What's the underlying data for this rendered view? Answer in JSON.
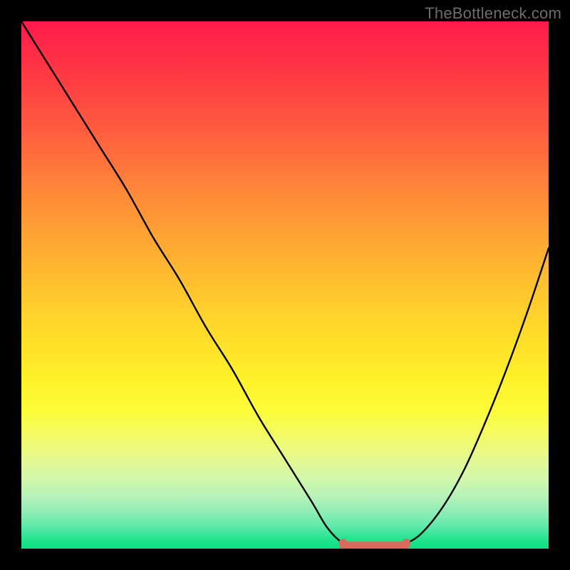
{
  "watermark": "TheBottleneck.com",
  "colors": {
    "marker": "#d96a5e",
    "curve": "#000000",
    "gradient_top": "#ff1a4b",
    "gradient_bottom": "#09e084"
  },
  "chart_data": {
    "type": "line",
    "title": "",
    "xlabel": "",
    "ylabel": "",
    "xlim": [
      0,
      100
    ],
    "ylim": [
      0,
      100
    ],
    "grid": false,
    "legend": false,
    "note": "Bottleneck-style V-curve. Y≈100 means heavy bottleneck (red), Y≈0 means balanced (green). Values are estimated from pixel positions; no numeric axes are shown in the source image.",
    "series": [
      {
        "name": "left_branch",
        "x": [
          0,
          5,
          10,
          15,
          20,
          25,
          30,
          35,
          40,
          45,
          50,
          55,
          58,
          61,
          64
        ],
        "y": [
          100,
          92,
          84,
          76,
          68,
          59,
          51,
          42,
          34,
          25,
          17,
          9,
          4,
          1,
          0
        ]
      },
      {
        "name": "optimum_flat",
        "x": [
          61,
          64,
          67,
          70,
          73
        ],
        "y": [
          0.5,
          0,
          0,
          0,
          0.5
        ]
      },
      {
        "name": "right_branch",
        "x": [
          70,
          73,
          76,
          80,
          84,
          88,
          92,
          96,
          100
        ],
        "y": [
          0,
          1,
          3,
          8,
          15,
          24,
          34,
          45,
          57
        ]
      }
    ],
    "highlight": {
      "name": "optimal_range_marker",
      "x_start": 61,
      "x_end": 73,
      "y": 0.5,
      "color": "#d96a5e"
    }
  }
}
